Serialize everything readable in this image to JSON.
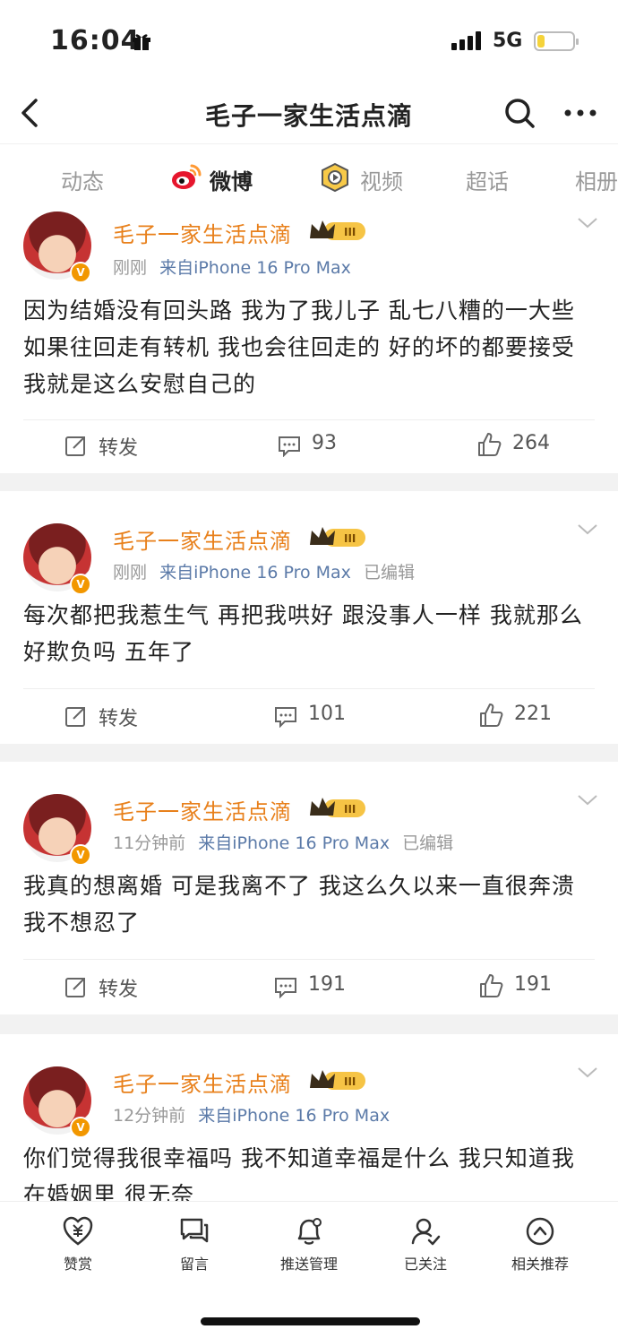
{
  "status_bar": {
    "time": "16:04",
    "network": "5G",
    "battery_level": 0.2
  },
  "nav": {
    "title": "毛子一家生活点滴"
  },
  "tabs": [
    {
      "label": "动态",
      "active": false
    },
    {
      "label": "微博",
      "active": true
    },
    {
      "label": "视频",
      "active": false
    },
    {
      "label": "超话",
      "active": false
    },
    {
      "label": "相册",
      "active": false
    }
  ],
  "posts": [
    {
      "username": "毛子一家生活点滴",
      "level_badge": "III",
      "time": "刚刚",
      "source": "来自iPhone 16 Pro Max",
      "edited": "",
      "text": "因为结婚没有回头路 我为了我儿子 乱七八糟的一大些 如果往回走有转机 我也会往回走的 好的坏的都要接受 我就是这么安慰自己的",
      "repost_label": "转发",
      "comments": "93",
      "likes": "264"
    },
    {
      "username": "毛子一家生活点滴",
      "level_badge": "III",
      "time": "刚刚",
      "source": "来自iPhone 16 Pro Max",
      "edited": "已编辑",
      "text": "每次都把我惹生气 再把我哄好 跟没事人一样 我就那么好欺负吗 五年了",
      "repost_label": "转发",
      "comments": "101",
      "likes": "221"
    },
    {
      "username": "毛子一家生活点滴",
      "level_badge": "III",
      "time": "11分钟前",
      "source": "来自iPhone 16 Pro Max",
      "edited": "已编辑",
      "text": "我真的想离婚 可是我离不了 我这么久以来一直很奔溃 我不想忍了",
      "repost_label": "转发",
      "comments": "191",
      "likes": "191"
    },
    {
      "username": "毛子一家生活点滴",
      "level_badge": "III",
      "time": "12分钟前",
      "source": "来自iPhone 16 Pro Max",
      "edited": "",
      "text": "你们觉得我很幸福吗 我不知道幸福是什么 我只知道我在婚姻里 很无奈",
      "repost_label": "",
      "comments": "",
      "likes": ""
    }
  ],
  "bottom_bar": [
    {
      "label": "赞赏",
      "icon": "reward-icon"
    },
    {
      "label": "留言",
      "icon": "message-icon"
    },
    {
      "label": "推送管理",
      "icon": "bell-icon"
    },
    {
      "label": "已关注",
      "icon": "followed-icon"
    },
    {
      "label": "相关推荐",
      "icon": "recommend-icon"
    }
  ],
  "colors": {
    "username": "#e8801b",
    "source": "#5b7aa8",
    "meta": "#999999",
    "accent": "#f29700"
  }
}
